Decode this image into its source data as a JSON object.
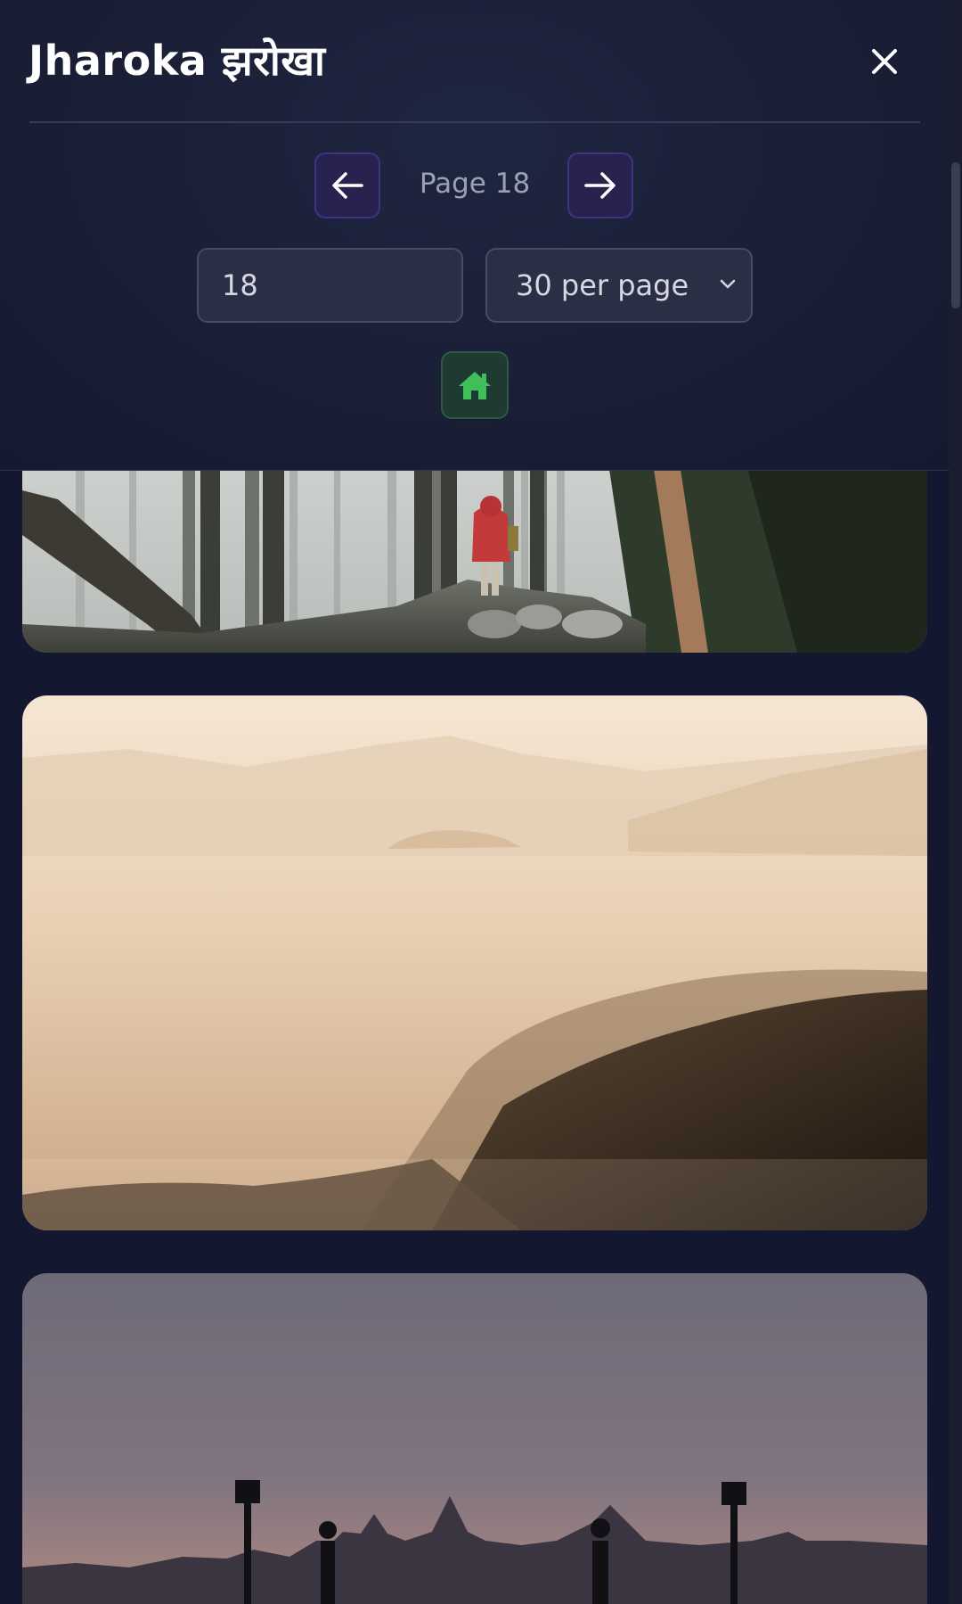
{
  "app": {
    "title": "Jharoka झरोखा"
  },
  "pagination": {
    "page_label": "Page 18",
    "page_input_value": "18",
    "per_page_selected": "30 per page"
  },
  "icons": {
    "close": "close-icon",
    "prev": "arrow-left-icon",
    "next": "arrow-right-icon",
    "select": "chevron-down-icon",
    "home": "home-icon"
  },
  "colors": {
    "background": "#131730",
    "arrow_button": "#28234e",
    "home_icon": "#3fbf5a"
  }
}
